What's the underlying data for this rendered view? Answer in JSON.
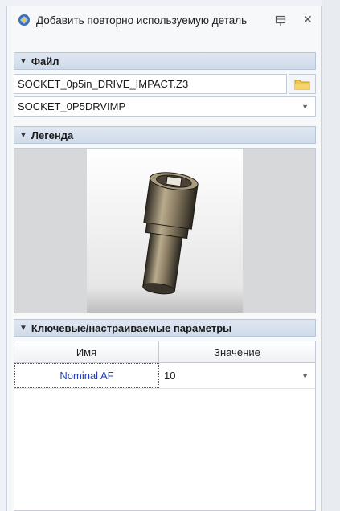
{
  "window": {
    "title": "Добавить повторно используемую деталь"
  },
  "sections": {
    "file": {
      "header": "Файл",
      "path_value": "SOCKET_0p5in_DRIVE_IMPACT.Z3",
      "part_selected": "SOCKET_0P5DRVIMP"
    },
    "legend": {
      "header": "Легенда"
    },
    "params": {
      "header": "Ключевые/настраиваемые параметры",
      "columns": [
        "Имя",
        "Значение"
      ],
      "rows": [
        {
          "name": "Nominal AF",
          "value": "10"
        }
      ]
    }
  },
  "icons": {
    "title": "part-library-icon",
    "pin": "pin-icon",
    "close": "close-icon",
    "folder": "folder-icon",
    "collapse": "triangle-down-icon"
  },
  "colors": {
    "accent_header": "#cfdaea",
    "param_name": "#1f3fbf",
    "folder": "#f2c744"
  }
}
